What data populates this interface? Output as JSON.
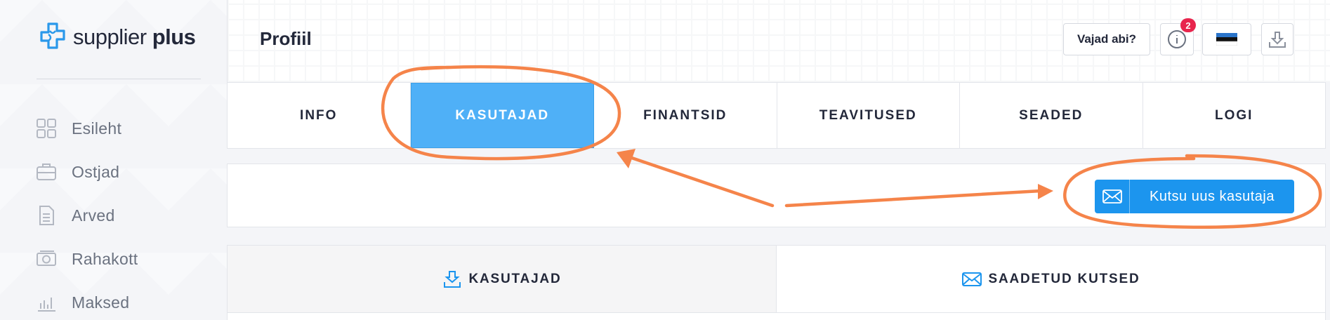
{
  "brand": {
    "name_light": "supplier",
    "name_bold": "plus"
  },
  "sidebar": {
    "items": [
      {
        "label": "Esileht",
        "icon": "dashboard-icon"
      },
      {
        "label": "Ostjad",
        "icon": "briefcase-icon"
      },
      {
        "label": "Arved",
        "icon": "document-icon"
      },
      {
        "label": "Rahakott",
        "icon": "wallet-icon"
      },
      {
        "label": "Maksed",
        "icon": "bar-chart-icon"
      }
    ]
  },
  "header": {
    "title": "Profiil",
    "help_label": "Vajad abi?",
    "notifications_count": "2",
    "info_icon": "info-icon",
    "language_icon": "flag-estonia-icon",
    "logout_icon": "logout-icon"
  },
  "tabs": [
    {
      "label": "INFO"
    },
    {
      "label": "KASUTAJAD",
      "active": true
    },
    {
      "label": "FINANTSID"
    },
    {
      "label": "TEAVITUSED"
    },
    {
      "label": "SEADED"
    },
    {
      "label": "LOGI"
    }
  ],
  "action_bar": {
    "invite_label": "Kutsu uus kasutaja",
    "invite_icon": "envelope-icon"
  },
  "subtabs": [
    {
      "label": "KASUTAJAD",
      "icon": "user-inbox-icon",
      "active": true
    },
    {
      "label": "SAADETUD KUTSED",
      "icon": "envelope-icon"
    }
  ],
  "colors": {
    "accent": "#1c95ee",
    "active_tab": "#4fb0f7",
    "badge": "#e8254d",
    "annotation": "#f5844a"
  }
}
